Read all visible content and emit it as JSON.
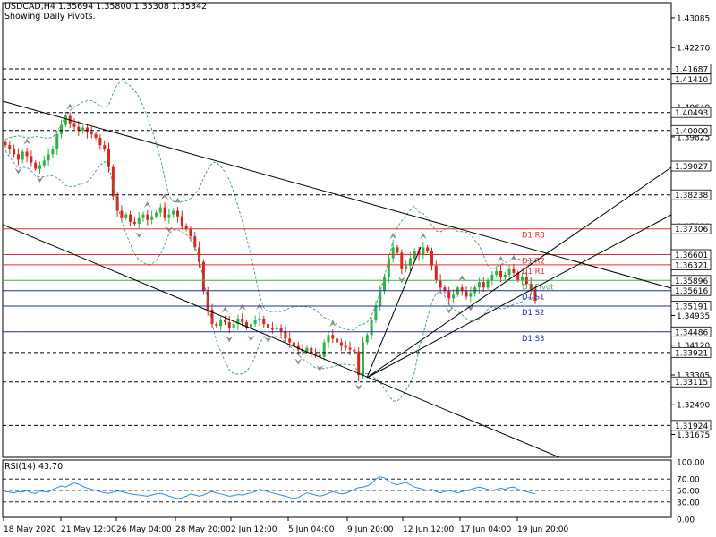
{
  "header": {
    "symbol_line": "USDCAD,H4  1.35694 1.35800 1.35308 1.35342",
    "pivot_note": "Showing Daily Pivots."
  },
  "rsi": {
    "title": "RSI(14) 43.70",
    "levels": [
      "100.00",
      "70.00",
      "50.00",
      "30.00",
      "0.00"
    ],
    "values": [
      48,
      47,
      46,
      48,
      47,
      50,
      46,
      45,
      49,
      48,
      47,
      52,
      55,
      58,
      56,
      60,
      63,
      61,
      57,
      54,
      52,
      50,
      48,
      46,
      45,
      47,
      49,
      48,
      46,
      44,
      43,
      42,
      41,
      40,
      42,
      44,
      45,
      43,
      40,
      38,
      36,
      37,
      40,
      44,
      42,
      40,
      42,
      46,
      48,
      46,
      44,
      42,
      40,
      41,
      43,
      42,
      44,
      46,
      48,
      52,
      50,
      48,
      46,
      44,
      42,
      40,
      38,
      36,
      38,
      42,
      46,
      44,
      42,
      40,
      42,
      45,
      48,
      46,
      44,
      45,
      48,
      52,
      55,
      56,
      58,
      62,
      70,
      74,
      72,
      66,
      62,
      60,
      62,
      64,
      60,
      56,
      54,
      52,
      50,
      52,
      48,
      46,
      48,
      50,
      48,
      46,
      48,
      50,
      52,
      54,
      56,
      54,
      52,
      50,
      52,
      54,
      52,
      55,
      56,
      52,
      50,
      48,
      46,
      44
    ],
    "colors": {
      "line": "#1e90ff",
      "level_line": "#000000"
    }
  },
  "price_axis": {
    "ticks": [
      "1.43085",
      "1.42270",
      "1.40640",
      "1.39825",
      "1.38205",
      "1.37390",
      "1.35750",
      "1.34935",
      "1.34120",
      "1.33305",
      "1.32490",
      "1.31675"
    ],
    "value_range": [
      1.3105,
      1.435
    ]
  },
  "levels": [
    {
      "value": "1.41687",
      "style": "dashed",
      "color": "#000000",
      "label": ""
    },
    {
      "value": "1.41410",
      "style": "dashed",
      "color": "#000000",
      "label": ""
    },
    {
      "value": "1.40493",
      "style": "dashed",
      "color": "#000000",
      "label": ""
    },
    {
      "value": "1.40000",
      "style": "dashed",
      "color": "#000000",
      "label": ""
    },
    {
      "value": "1.39027",
      "style": "dashed",
      "color": "#000000",
      "label": ""
    },
    {
      "value": "1.38238",
      "style": "dashed",
      "color": "#000000",
      "label": ""
    },
    {
      "value": "1.37306",
      "style": "solid",
      "color": "#e0302a",
      "label": "D1  R3"
    },
    {
      "value": "1.36601",
      "style": "solid",
      "color": "#e0302a",
      "label": "D1  R2"
    },
    {
      "value": "1.36321",
      "style": "solid",
      "color": "#e0302a",
      "label": "D1  R1"
    },
    {
      "value": "1.35896",
      "style": "solid",
      "color": "#3cb34a",
      "label": "D1 Pivot"
    },
    {
      "value": "1.35616",
      "style": "solid",
      "color": "#1f2ea8",
      "label": "D1  S1"
    },
    {
      "value": "1.35191",
      "style": "solid",
      "color": "#1f2ea8",
      "label": "D1  S2"
    },
    {
      "value": "1.34486",
      "style": "solid",
      "color": "#1f2ea8",
      "label": "D1  S3"
    },
    {
      "value": "1.33921",
      "style": "dashed",
      "color": "#000000",
      "label": ""
    },
    {
      "value": "1.33115",
      "style": "dashed",
      "color": "#000000",
      "label": ""
    },
    {
      "value": "1.31924",
      "style": "dashed",
      "color": "#000000",
      "label": ""
    }
  ],
  "time_axis": [
    "18 May 2020",
    "21 May 12:00",
    "26 May 04:00",
    "28 May 20:00",
    "2 Jun 12:00",
    "5 Jun 04:00",
    "9 Jun 20:00",
    "12 Jun 12:00",
    "17 Jun 04:00",
    "19 Jun 20:00"
  ],
  "closes": [
    1.396,
    1.3948,
    1.3935,
    1.392,
    1.3942,
    1.393,
    1.3912,
    1.3895,
    1.3905,
    1.3918,
    1.3935,
    1.395,
    1.399,
    1.4015,
    1.404,
    1.402,
    1.401,
    1.4,
    1.4008,
    1.3995,
    1.399,
    1.398,
    1.396,
    1.395,
    1.39,
    1.382,
    1.378,
    1.376,
    1.377,
    1.375,
    1.3745,
    1.376,
    1.377,
    1.3755,
    1.3765,
    1.3775,
    1.379,
    1.376,
    1.377,
    1.378,
    1.3765,
    1.374,
    1.373,
    1.371,
    1.368,
    1.364,
    1.356,
    1.351,
    1.347,
    1.3465,
    1.348,
    1.3475,
    1.346,
    1.347,
    1.3485,
    1.3475,
    1.346,
    1.347,
    1.348,
    1.3485,
    1.347,
    1.346,
    1.3455,
    1.346,
    1.345,
    1.343,
    1.342,
    1.341,
    1.34,
    1.3395,
    1.3405,
    1.339,
    1.3385,
    1.338,
    1.342,
    1.344,
    1.343,
    1.342,
    1.341,
    1.3405,
    1.34,
    1.3395,
    1.333,
    1.342,
    1.344,
    1.348,
    1.352,
    1.356,
    1.36,
    1.365,
    1.368,
    1.3665,
    1.362,
    1.363,
    1.365,
    1.367,
    1.366,
    1.368,
    1.367,
    1.363,
    1.359,
    1.357,
    1.356,
    1.354,
    1.355,
    1.357,
    1.356,
    1.3545,
    1.3555,
    1.357,
    1.3585,
    1.357,
    1.359,
    1.3605,
    1.3615,
    1.36,
    1.3605,
    1.362,
    1.361,
    1.359,
    1.36,
    1.358,
    1.3565,
    1.3534
  ],
  "colors": {
    "bull": "#2fb344",
    "bear": "#d9261c",
    "grid": "#000000",
    "channel": "#000000",
    "bands": "#3a9a7a",
    "fractal": "#8c8c8c"
  }
}
